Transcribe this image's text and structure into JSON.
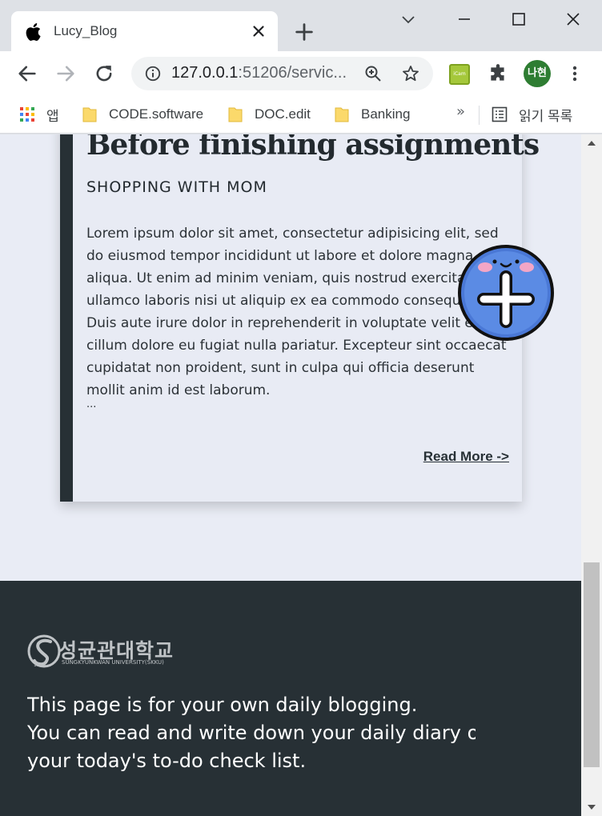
{
  "browser": {
    "tab": {
      "title": "Lucy_Blog",
      "favicon": "apple-logo-icon"
    },
    "address_bar": {
      "host": "127.0.0.1",
      "rest": ":51206/servic..."
    },
    "profile": {
      "initials": "나현",
      "color": "#2e7d32"
    },
    "extensions": [
      {
        "name": "icam-extension",
        "label": "iCam"
      },
      {
        "name": "puzzle-icon"
      }
    ],
    "bookmarks": [
      {
        "label": "앱",
        "icon": "apps-grid-icon"
      },
      {
        "label": "CODE.software",
        "icon": "folder-icon"
      },
      {
        "label": "DOC.edit",
        "icon": "folder-icon"
      },
      {
        "label": "Banking",
        "icon": "folder-icon"
      }
    ],
    "bookmarks_more": "»",
    "reading_list": "읽기 목록"
  },
  "post": {
    "title": "Before finishing assignments",
    "subtitle": "SHOPPING WITH MOM",
    "body": "Lorem ipsum dolor sit amet, consectetur adipisicing elit, sed do eiusmod tempor incididunt ut labore et dolore magna aliqua. Ut enim ad minim veniam, quis nostrud exercitation ullamco laboris nisi ut aliquip ex ea commodo consequat. Duis aute irure dolor in reprehenderit in voluptate velit esse cillum dolore eu fugiat nulla pariatur. Excepteur sint occaecat cupidatat non proident, sunt in culpa qui officia deserunt mollit anim id est laborum.",
    "ellipsis": "...",
    "read_more": "Read More ->"
  },
  "footer": {
    "logo_ko": "성균관대학교",
    "logo_en": "SUNGKYUNKWAN UNIVERSITY(SKKU)",
    "logo_year": "1398",
    "line1": "This page is for your own daily blogging.",
    "line2": "You can read and write down your daily diary or",
    "line3": "your today's to-do check list."
  },
  "colors": {
    "page_bg": "#e9ecf5",
    "card_accent": "#273035",
    "footer_bg": "#273035",
    "fab_blue": "#4a78d6"
  }
}
